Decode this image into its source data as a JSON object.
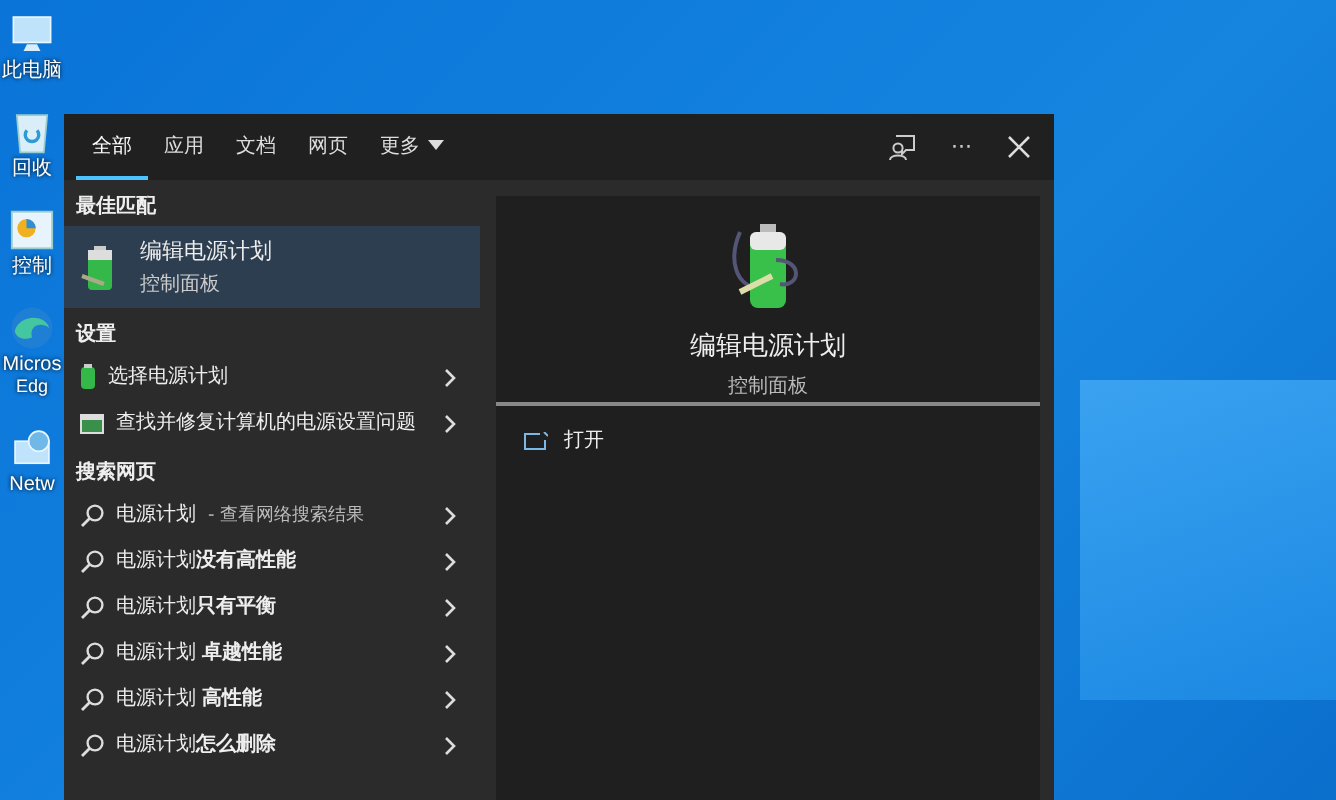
{
  "desktop_icons": [
    {
      "kind": "computer",
      "lines": [
        "此电脑"
      ]
    },
    {
      "kind": "recycle",
      "lines": [
        "回收"
      ]
    },
    {
      "kind": "control",
      "lines": [
        "控制"
      ]
    },
    {
      "kind": "edge",
      "lines": [
        "Micros",
        "Edg"
      ]
    },
    {
      "kind": "network",
      "lines": [
        "Netw"
      ]
    }
  ],
  "tabs": [
    {
      "label": "全部",
      "selected": true
    },
    {
      "label": "应用",
      "selected": false
    },
    {
      "label": "文档",
      "selected": false
    },
    {
      "label": "网页",
      "selected": false
    },
    {
      "label": "更多",
      "selected": false,
      "dropdown": true
    }
  ],
  "header_actions": {
    "more": "···"
  },
  "best_match": {
    "heading": "最佳匹配",
    "title": "编辑电源计划",
    "subtitle": "控制面板",
    "selected": true
  },
  "settings": {
    "heading": "设置",
    "items": [
      {
        "kind": "battery",
        "label": "选择电源计划"
      },
      {
        "kind": "troubleshoot",
        "label": "查找并修复计算机的电源设置问题"
      }
    ]
  },
  "web": {
    "heading": "搜索网页",
    "items": [
      {
        "text": "电源计划",
        "suffix": "- 查看网络搜索结果"
      },
      {
        "text": "电源计划**没有高性能**"
      },
      {
        "text": "电源计划**只有平衡**"
      },
      {
        "text": "电源计划 **卓越性能**"
      },
      {
        "text": "电源计划 **高性能**"
      },
      {
        "text": "电源计划**怎么删除**"
      }
    ]
  },
  "preview": {
    "title": "编辑电源计划",
    "subtitle": "控制面板",
    "actions": [
      {
        "label": "打开"
      }
    ]
  }
}
